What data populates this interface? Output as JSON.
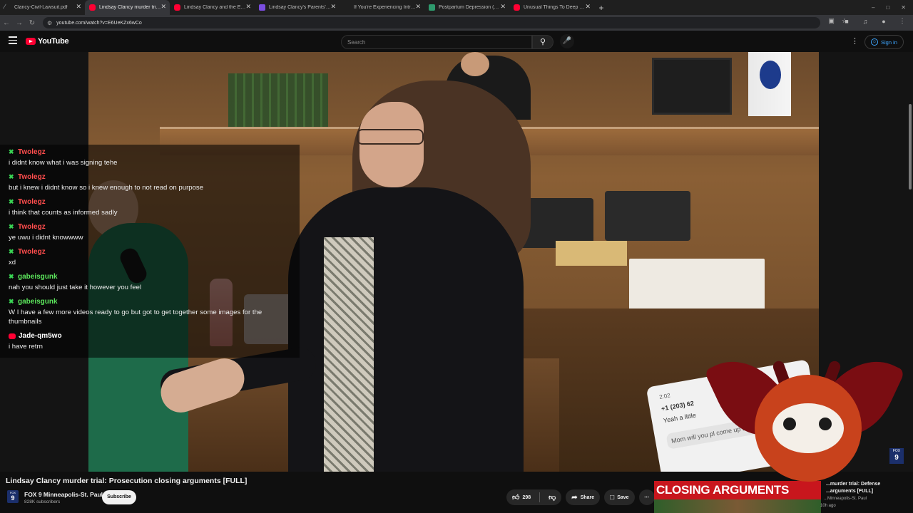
{
  "browser": {
    "tabs": [
      {
        "title": "Clancy-Civil-Lawsuit.pdf",
        "icon": "pdf-icon",
        "active": false
      },
      {
        "title": "Lindsay Clancy murder trial: Pro",
        "icon": "youtube-icon",
        "active": true
      },
      {
        "title": "Lindsay Clancy and the Evidenc",
        "icon": "youtube-icon",
        "active": false
      },
      {
        "title": "Lindsay Clancy's Parents' $1 Mi",
        "icon": "purple-site-icon",
        "active": false
      },
      {
        "title": "If You're Experiencing Intrusive",
        "icon": "blank-page-icon",
        "active": false
      },
      {
        "title": "Postpartum Depression (PPD) -",
        "icon": "green-site-icon",
        "active": false
      },
      {
        "title": "Unusual Things To Deep Fry - Y",
        "icon": "youtube-icon",
        "active": false
      }
    ],
    "new_tab": "+",
    "url": "youtube.com/watch?v=E6UeKZx6wCo"
  },
  "masthead": {
    "logo": "YouTube",
    "search_placeholder": "Search",
    "sign_in": "Sign in"
  },
  "chat": [
    {
      "author": "Twolegz",
      "color": "#ff4d4d",
      "badge": "green",
      "text": "i didnt know what i was signing tehe"
    },
    {
      "author": "Twolegz",
      "color": "#ff4d4d",
      "badge": "green",
      "text": "but i knew i didnt know so i knew enough to not read on purpose"
    },
    {
      "author": "Twolegz",
      "color": "#ff4d4d",
      "badge": "green",
      "text": "i think that counts as informed sadly"
    },
    {
      "author": "Twolegz",
      "color": "#ff4d4d",
      "badge": "green",
      "text": "ye uwu i didnt knowwww"
    },
    {
      "author": "Twolegz",
      "color": "#ff4d4d",
      "badge": "green",
      "text": "xd"
    },
    {
      "author": "gabeisgunk",
      "color": "#5ce65c",
      "badge": "green",
      "text": "nah you should just take it however you feel"
    },
    {
      "author": "gabeisgunk",
      "color": "#5ce65c",
      "badge": "green",
      "text": "W I have a few more videos ready to go but got to get together some images for the thumbnails"
    },
    {
      "author": "Jade-qm5wo",
      "color": "#ffffff",
      "badge": "red",
      "text": "i have retrn"
    }
  ],
  "video_overlay": {
    "phone_time": "2:02",
    "phone_number": "+1 (203) 62",
    "phone_line": "Yeah a little",
    "phone_bubble": "Mom will you pl come up and sta for a bit. I'm",
    "corner_logo": "FOX",
    "corner_logo_num": "9"
  },
  "video": {
    "title": "Lindsay Clancy murder trial: Prosecution closing arguments [FULL]",
    "channel": "FOX 9 Minneapolis-St. Paul",
    "subscribers": "828K subscribers",
    "avatar_top": "FOX",
    "avatar_num": "9",
    "subscribe": "Subscribe",
    "likes": "298",
    "share": "Share",
    "save": "Save"
  },
  "recommended": {
    "banner": "CLOSING ARGUMENTS",
    "title": "...murder trial: Defense ...arguments [FULL]",
    "channel": "...Minneapolis-St. Paul",
    "ago": "10h ago"
  },
  "colors": {
    "youtube_red": "#ff0033",
    "link_blue": "#3ea6ff",
    "banner_red": "#c8161d"
  }
}
